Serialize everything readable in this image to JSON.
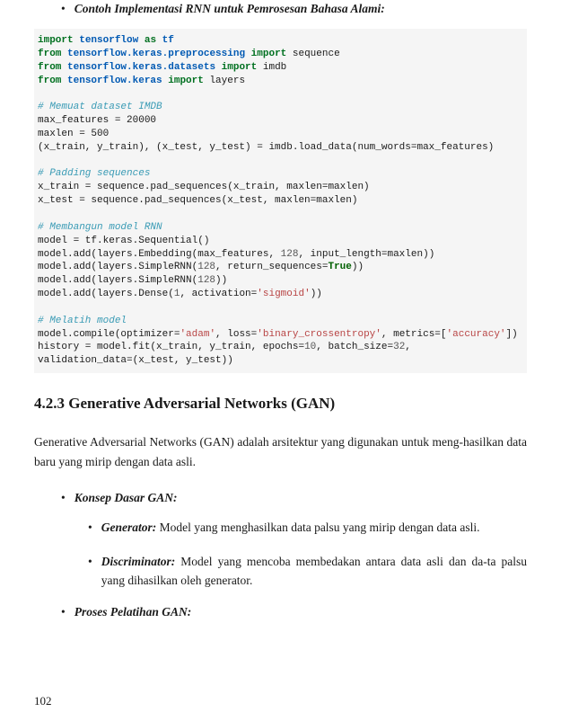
{
  "top_bullet": "Contoh Implementasi RNN untuk Pemrosesan Bahasa Alami:",
  "code": {
    "l01a": "import",
    "l01b": "tensorflow",
    "l01c": "as",
    "l01d": "tf",
    "l02a": "from",
    "l02b": "tensorflow.keras.preprocessing",
    "l02c": "import",
    "l02d": " sequence",
    "l03a": "from",
    "l03b": "tensorflow.keras.datasets",
    "l03c": "import",
    "l03d": " imdb",
    "l04a": "from",
    "l04b": "tensorflow.keras",
    "l04c": "import",
    "l04d": " layers",
    "c1": "# Memuat dataset IMDB",
    "l05": "max_features = 20000",
    "l06": "maxlen = 500",
    "l07": "(x_train, y_train), (x_test, y_test) = imdb.load_data(num_words=max_features)",
    "c2": "# Padding sequences",
    "l08": "x_train = sequence.pad_sequences(x_train, maxlen=maxlen)",
    "l09": "x_test = sequence.pad_sequences(x_test, maxlen=maxlen)",
    "c3": "# Membangun model RNN",
    "l10": "model = tf.keras.Sequential()",
    "l11a": "model.add(layers.Embedding(max_features, ",
    "l11b": "128",
    "l11c": ", input_length=maxlen))",
    "l12a": "model.add(layers.SimpleRNN(",
    "l12b": "128",
    "l12c": ", return_sequences=",
    "l12d": "True",
    "l12e": "))",
    "l13a": "model.add(layers.SimpleRNN(",
    "l13b": "128",
    "l13c": "))",
    "l14a": "model.add(layers.Dense(",
    "l14b": "1",
    "l14c": ", activation=",
    "l14d": "'sigmoid'",
    "l14e": "))",
    "c4": "# Melatih model",
    "l15a": "model.compile(optimizer=",
    "l15b": "'adam'",
    "l15c": ", loss=",
    "l15d": "'binary_crossentropy'",
    "l15e": ", metrics=[",
    "l15f": "'accuracy'",
    "l15g": "])",
    "l16a": "history = model.fit(x_train, y_train, epochs=",
    "l16b": "10",
    "l16c": ", batch_size=",
    "l16d": "32",
    "l16e": ",",
    "l17": "validation_data=(x_test, y_test))"
  },
  "section_heading": "4.2.3 Generative Adversarial Networks (GAN)",
  "intro_para": "Generative Adversarial Networks (GAN) adalah arsitektur yang digunakan untuk meng-hasilkan data baru yang mirip dengan data asli.",
  "bullet_konsep": "Konsep Dasar GAN:",
  "gen_label": "Generator:",
  "gen_text": " Model yang menghasilkan data palsu yang mirip dengan data asli.",
  "disc_label": "Discriminator:",
  "disc_text": " Model yang mencoba membedakan antara data asli dan da-ta palsu yang dihasilkan oleh generator.",
  "bullet_proses": "Proses Pelatihan GAN:",
  "page_number": "102"
}
